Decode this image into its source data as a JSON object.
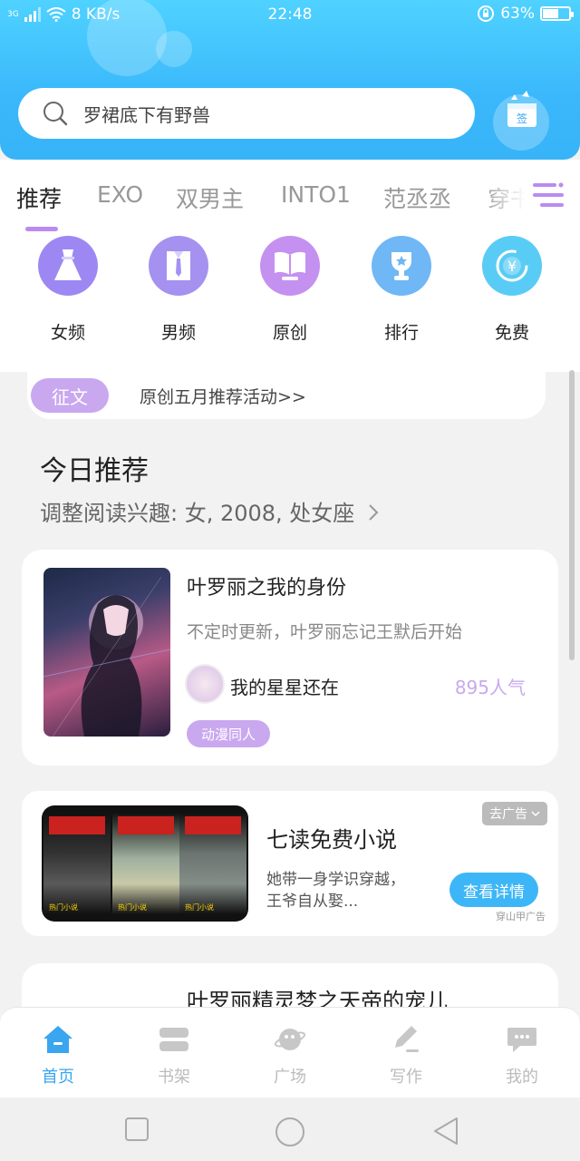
{
  "status_bar": {
    "network": "3G",
    "speed": "8 KB/s",
    "time": "22:48",
    "battery": "63%",
    "battery_level": 0.63
  },
  "search": {
    "text": "罗裙底下有野兽"
  },
  "sign_in": {
    "label": "签"
  },
  "tabs": [
    {
      "label": "推荐"
    },
    {
      "label": "EXO"
    },
    {
      "label": "双男主"
    },
    {
      "label": "INTO1"
    },
    {
      "label": "范丞丞"
    },
    {
      "label": "穿书"
    }
  ],
  "categories": [
    {
      "label": "女频",
      "icon": "dress-icon",
      "color": "#a08af2"
    },
    {
      "label": "男频",
      "icon": "shirt-icon",
      "color": "#a591f0"
    },
    {
      "label": "原创",
      "icon": "book-icon",
      "color": "#c591f0"
    },
    {
      "label": "排行",
      "icon": "trophy-icon",
      "color": "#6fb7f5"
    },
    {
      "label": "免费",
      "icon": "yuan-icon",
      "color": "#59ccf5"
    }
  ],
  "banner": {
    "tag": "征文",
    "text": "原创五月推荐活动>>"
  },
  "section": {
    "title": "今日推荐",
    "subtitle": "调整阅读兴趣: 女, 2008, 处女座"
  },
  "book": {
    "title": "叶罗丽之我的身份",
    "desc": "不定时更新，叶罗丽忘记王默后开始",
    "author": "我的星星还在",
    "popularity": "895人气",
    "genre": "动漫同人"
  },
  "ad": {
    "badge": "去广告",
    "title": "七读免费小说",
    "desc": "她带一身学识穿越，王爷自从娶...",
    "button": "查看详情",
    "source": "穿山甲广告",
    "panel_label": "热门小说"
  },
  "next_book": {
    "title": "叶罗丽精灵梦之天帝的宠儿"
  },
  "bottom_nav": [
    {
      "label": "首页",
      "icon": "home-icon"
    },
    {
      "label": "书架",
      "icon": "bookshelf-icon"
    },
    {
      "label": "广场",
      "icon": "planet-icon"
    },
    {
      "label": "写作",
      "icon": "pen-icon"
    },
    {
      "label": "我的",
      "icon": "chat-icon"
    }
  ],
  "colors": {
    "accent": "#39a6ef",
    "purple": "#c9a8ef",
    "header": "#3ab8fb"
  }
}
